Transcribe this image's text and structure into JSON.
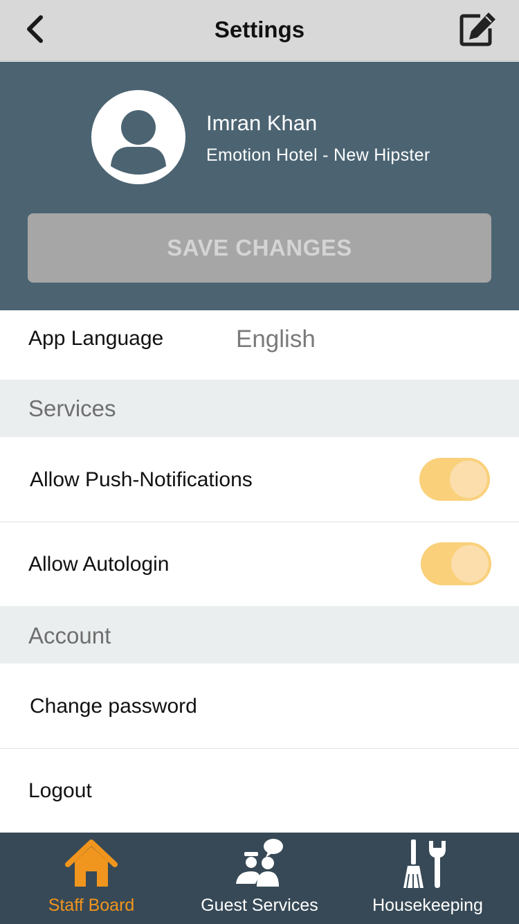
{
  "header": {
    "title": "Settings",
    "back_icon": "chevron-left-icon",
    "edit_icon": "edit-icon"
  },
  "profile": {
    "name": "Imran Khan",
    "hotel": "Emotion Hotel - New Hipster",
    "avatar_icon": "user-avatar-icon",
    "save_label": "SAVE CHANGES"
  },
  "language": {
    "label": "App Language",
    "value": "English"
  },
  "services": {
    "title": "Services",
    "push_label": "Allow Push-Notifications",
    "push_enabled": true,
    "autologin_label": "Allow Autologin",
    "autologin_enabled": true
  },
  "account": {
    "title": "Account",
    "change_password": "Change password",
    "logout": "Logout"
  },
  "tabs": [
    {
      "label": "Staff Board",
      "icon": "home-icon",
      "active": true
    },
    {
      "label": "Guest Services",
      "icon": "guest-services-icon",
      "active": false
    },
    {
      "label": "Housekeeping",
      "icon": "housekeeping-icon",
      "active": false
    }
  ],
  "colors": {
    "header_bg": "#d8d8d8",
    "profile_bg": "#4c6472",
    "toggle_on": "#fad07a",
    "tabbar_bg": "#374956",
    "active_tab": "#f0951d"
  }
}
